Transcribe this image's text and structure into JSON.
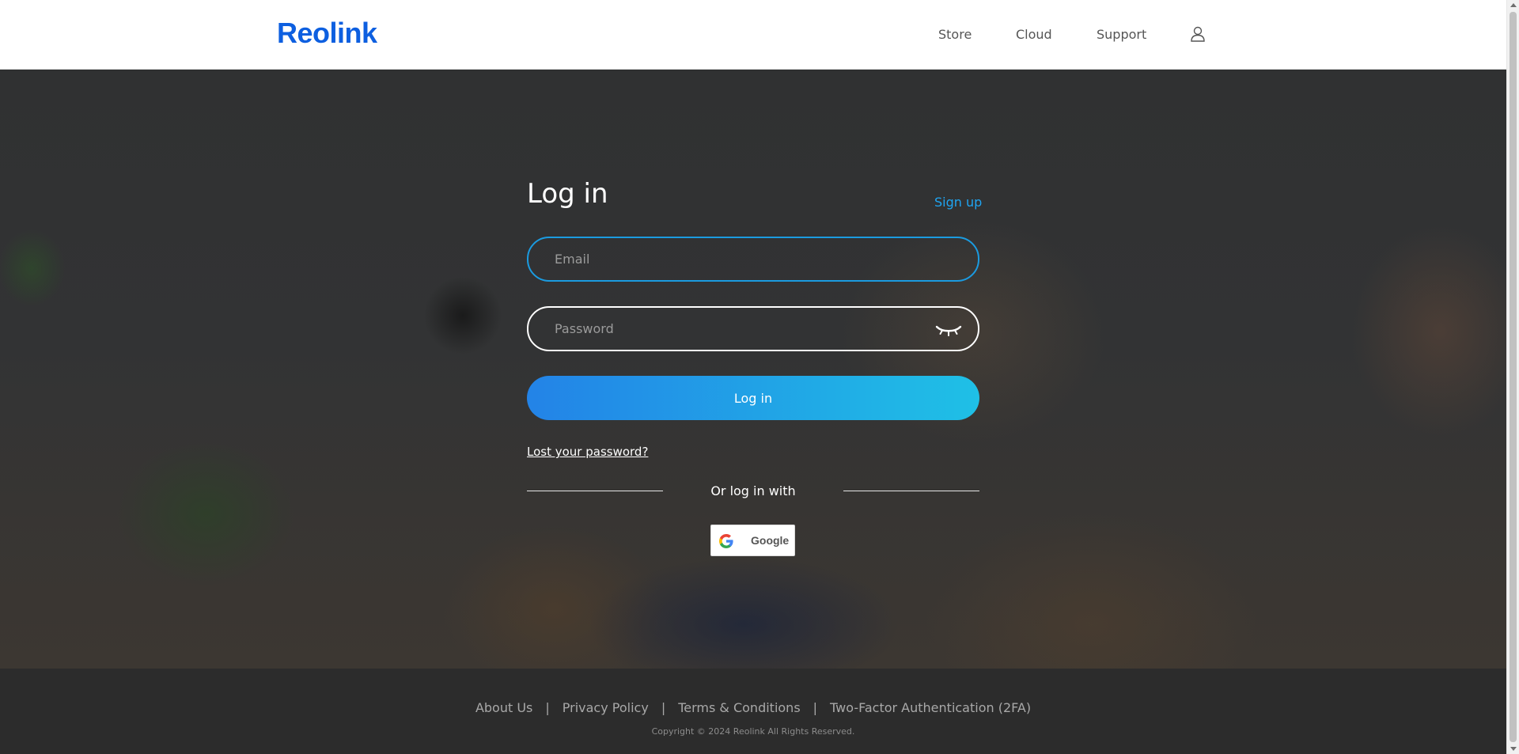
{
  "header": {
    "logo_text": "Reolink",
    "nav": [
      {
        "label": "Store"
      },
      {
        "label": "Cloud"
      },
      {
        "label": "Support"
      }
    ],
    "account_icon": "user-icon"
  },
  "login": {
    "title": "Log in",
    "signup_label": "Sign up",
    "email_placeholder": "Email",
    "email_value": "",
    "password_placeholder": "Password",
    "password_value": "",
    "password_toggle_icon": "eye-closed-icon",
    "submit_label": "Log in",
    "lost_password_label": "Lost your password?",
    "or_text": "Or log in with",
    "google_label": "Google",
    "google_icon": "google-icon"
  },
  "footer": {
    "links": [
      {
        "label": "About Us"
      },
      {
        "label": "Privacy Policy"
      },
      {
        "label": "Terms & Conditions"
      },
      {
        "label": "Two-Factor Authentication (2FA)"
      }
    ],
    "separator": "|",
    "copyright": "Copyright © 2024 Reolink All Rights Reserved."
  },
  "colors": {
    "brand": "#0d5fe0",
    "accent": "#1fa5f2",
    "button_gradient_start": "#2383e7",
    "button_gradient_end": "#1fc0e6"
  }
}
